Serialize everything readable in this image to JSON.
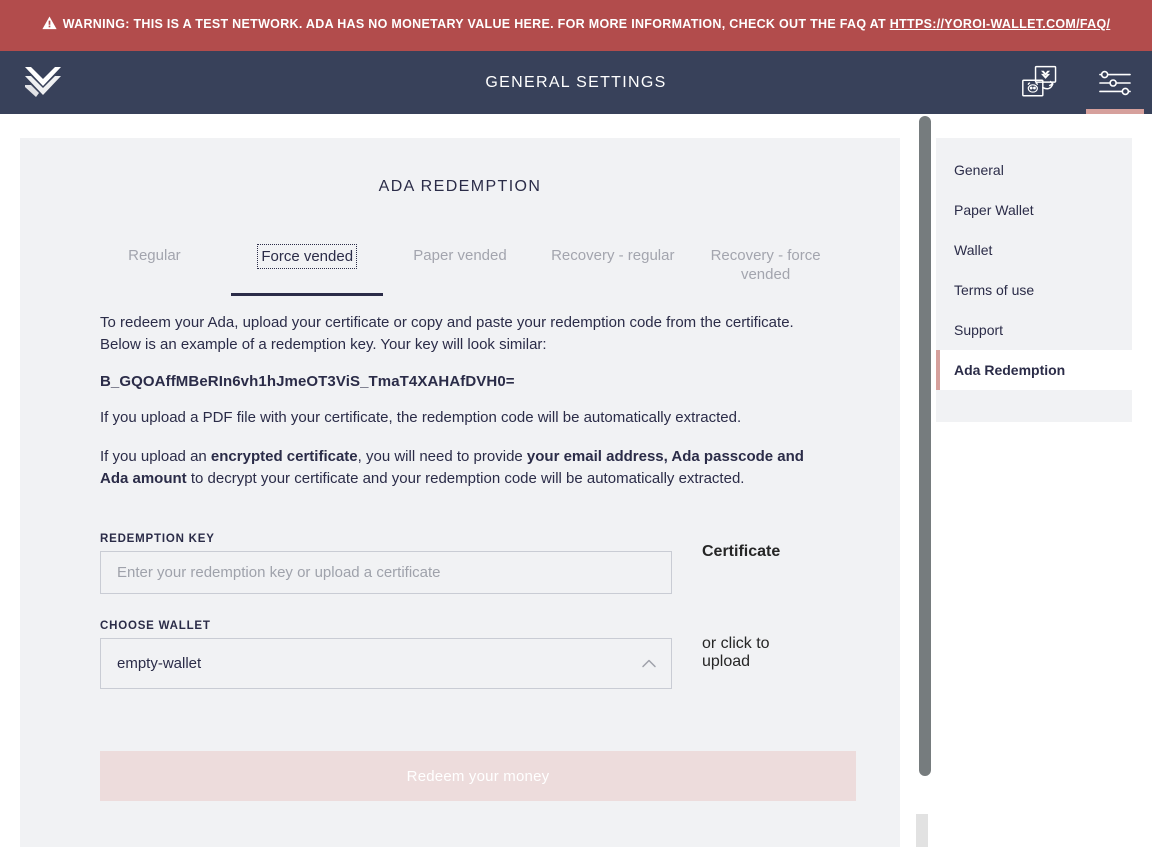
{
  "warning": {
    "icon": "warning-triangle-icon",
    "text": "WARNING: THIS IS A TEST NETWORK. ADA HAS NO MONETARY VALUE HERE. FOR MORE INFORMATION, CHECK OUT THE FAQ AT ",
    "link_text": "HTTPS://YOROI-WALLET.COM/FAQ/"
  },
  "topbar": {
    "logo": "yoroi-logo-icon",
    "title": "GENERAL SETTINGS",
    "actions": [
      {
        "name": "wallet-transfer-icon",
        "label": "Wallet transfer",
        "active": false
      },
      {
        "name": "settings-sliders-icon",
        "label": "Settings",
        "active": true
      }
    ]
  },
  "page": {
    "card_title": "ADA REDEMPTION",
    "tabs": [
      {
        "label": "Regular",
        "active": false
      },
      {
        "label": "Force vended",
        "active": true
      },
      {
        "label": "Paper vended",
        "active": false
      },
      {
        "label": "Recovery - regular",
        "active": false
      },
      {
        "label": "Recovery - force vended",
        "active": false
      }
    ],
    "paragraph_1": "To redeem your Ada, upload your certificate or copy and paste your redemption code from the certificate. Below is an example of a redemption key. Your key will look similar:",
    "example_key": "B_GQOAffMBeRIn6vh1hJmeOT3ViS_TmaT4XAHAfDVH0=",
    "paragraph_2": "If you upload a PDF file with your certificate, the redemption code will be automatically extracted.",
    "paragraph_3": {
      "part_1": "If you upload an ",
      "bold_1": "encrypted certificate",
      "part_2": ", you will need to provide ",
      "bold_2": "your email address, Ada passcode and Ada amount",
      "part_3": " to decrypt your certificate and your redemption code will be automatically extracted."
    },
    "form": {
      "redemption_key_label": "REDEMPTION KEY",
      "redemption_key_value": "",
      "redemption_key_placeholder": "Enter your redemption key or upload a certificate",
      "choose_wallet_label": "CHOOSE WALLET",
      "choose_wallet_value": "empty-wallet",
      "choose_wallet_caret": "chevron-up-icon"
    },
    "certificate": {
      "title": "Certificate",
      "upload_text": "or click to upload"
    },
    "submit_label": "Redeem your money"
  },
  "sidebar": {
    "items": [
      {
        "label": "General",
        "active": false
      },
      {
        "label": "Paper Wallet",
        "active": false
      },
      {
        "label": "Wallet",
        "active": false
      },
      {
        "label": "Terms of use",
        "active": false
      },
      {
        "label": "Support",
        "active": false
      },
      {
        "label": "Ada Redemption",
        "active": true
      }
    ]
  },
  "colors": {
    "warning_bg": "#b24c4c",
    "topbar_bg": "#38415a",
    "accent_salmon": "#d6a09c",
    "card_bg": "#f1f2f4",
    "text_dark": "#2b2c48",
    "submit_disabled": "#eddcdc"
  }
}
